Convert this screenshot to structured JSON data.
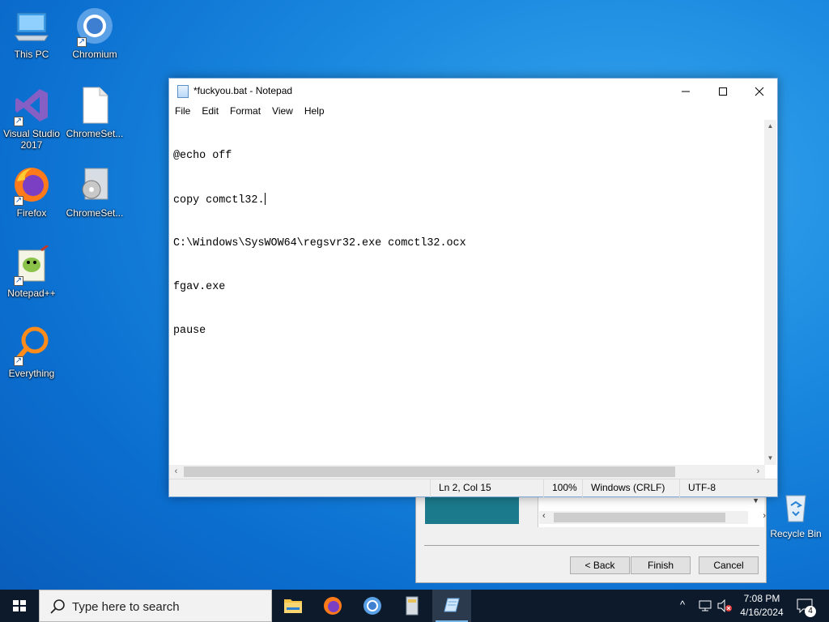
{
  "desktop": {
    "icons": [
      {
        "label": "This PC"
      },
      {
        "label": "Chromium"
      },
      {
        "label": "Visual Studio 2017"
      },
      {
        "label": "ChromeSet..."
      },
      {
        "label": "Firefox"
      },
      {
        "label": "ChromeSet..."
      },
      {
        "label": "Notepad++"
      },
      {
        "label": "Everything"
      }
    ],
    "recycle_bin": "Recycle Bin"
  },
  "wizard": {
    "back_label": "< Back",
    "finish_label": "Finish",
    "cancel_label": "Cancel"
  },
  "notepad": {
    "title": "*fuckyou.bat - Notepad",
    "menu": [
      "File",
      "Edit",
      "Format",
      "View",
      "Help"
    ],
    "lines": [
      "@echo off",
      "copy comctl32.",
      "C:\\Windows\\SysWOW64\\regsvr32.exe comctl32.ocx",
      "fgav.exe",
      "pause"
    ],
    "status": {
      "position": "Ln 2, Col 15",
      "zoom": "100%",
      "line_ending": "Windows (CRLF)",
      "encoding": "UTF-8"
    }
  },
  "taskbar": {
    "search_placeholder": "Type here to search",
    "time": "7:08 PM",
    "date": "4/16/2024",
    "notification_count": "4"
  }
}
